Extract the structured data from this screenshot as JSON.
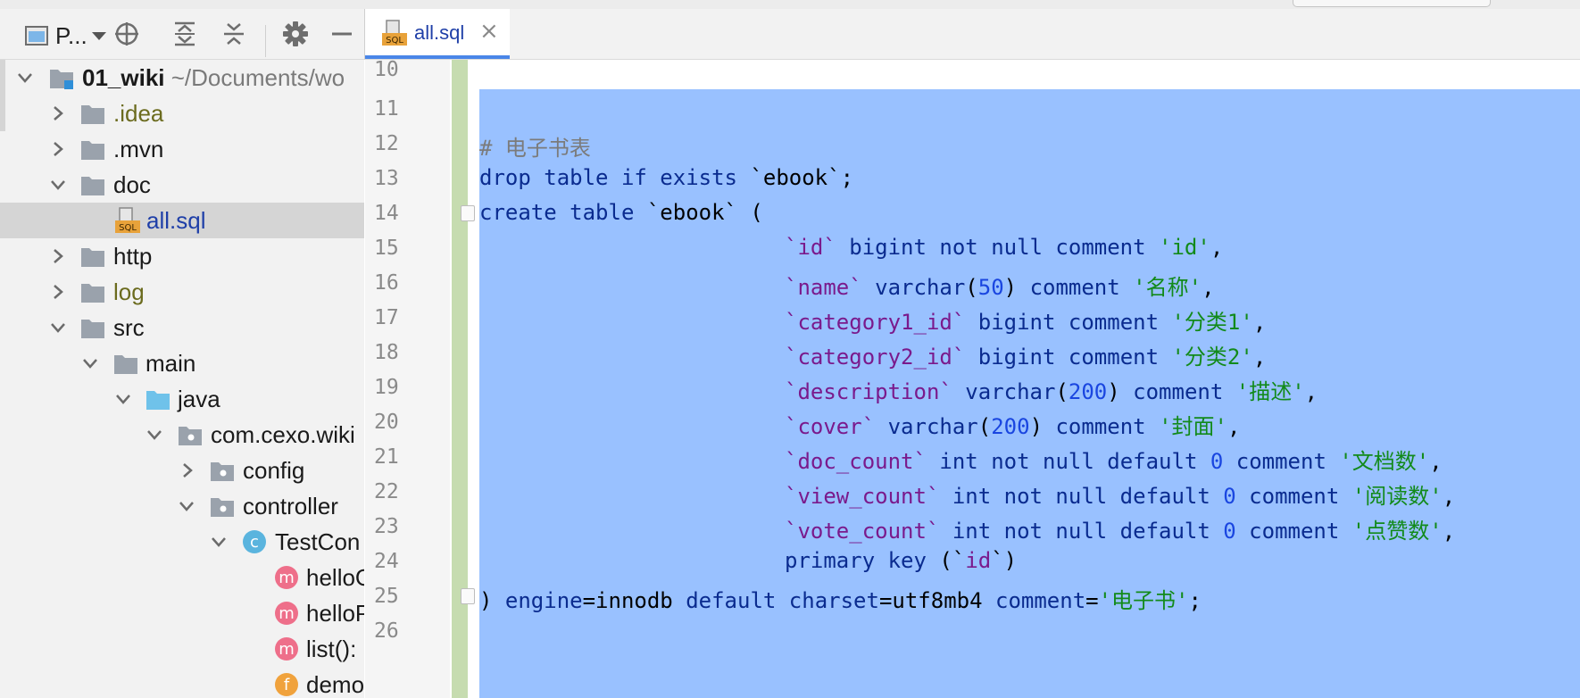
{
  "toolbar": {
    "project_label": "P...",
    "project_dropdown_icon": "triangle-down-icon"
  },
  "tabs": [
    {
      "label": "all.sql",
      "file_type_icon": "SQL",
      "active": true
    }
  ],
  "tree": {
    "root": {
      "label": "01_wiki",
      "path": "~/Documents/wo"
    },
    "items": [
      {
        "label": ".idea"
      },
      {
        "label": ".mvn"
      },
      {
        "label": "doc"
      },
      {
        "label": "all.sql",
        "icon_text": "SQL"
      },
      {
        "label": "http"
      },
      {
        "label": "log"
      },
      {
        "label": "src"
      },
      {
        "label": "main"
      },
      {
        "label": "java"
      },
      {
        "label": "com.cexo.wiki"
      },
      {
        "label": "config"
      },
      {
        "label": "controller"
      },
      {
        "label": "TestCon",
        "badge": "c"
      },
      {
        "label": "helloG",
        "badge": "m"
      },
      {
        "label": "helloP",
        "badge": "m"
      },
      {
        "label": "list():",
        "badge": "m"
      },
      {
        "label": "demo",
        "badge": "f"
      }
    ]
  },
  "editor": {
    "line_numbers": [
      "10",
      "11",
      "12",
      "13",
      "14",
      "15",
      "16",
      "17",
      "18",
      "19",
      "20",
      "21",
      "22",
      "23",
      "24",
      "25",
      "26"
    ],
    "lines": {
      "l12": {
        "cmt": "# 电子书表"
      },
      "l13": {
        "kw1": "drop table if exists",
        "ident": " `ebook`",
        "end": ";"
      },
      "l14": {
        "kw1": "create table",
        "ident": " `ebook`",
        "end": " ("
      },
      "l15": {
        "ident": "`id`",
        "kw1": " bigint not null comment ",
        "str": "'id'",
        "end": ","
      },
      "l16": {
        "ident": "`name`",
        "kw1": " varchar",
        "p1": "(",
        "num": "50",
        "p2": ") ",
        "kw2": "comment ",
        "str": "'名称'",
        "end": ","
      },
      "l17": {
        "ident": "`category1_id`",
        "kw1": " bigint comment ",
        "str": "'分类1'",
        "end": ","
      },
      "l18": {
        "ident": "`category2_id`",
        "kw1": " bigint comment ",
        "str": "'分类2'",
        "end": ","
      },
      "l19": {
        "ident": "`description`",
        "kw1": " varchar",
        "p1": "(",
        "num": "200",
        "p2": ") ",
        "kw2": "comment ",
        "str": "'描述'",
        "end": ","
      },
      "l20": {
        "ident": "`cover`",
        "kw1": " varchar",
        "p1": "(",
        "num": "200",
        "p2": ") ",
        "kw2": "comment ",
        "str": "'封面'",
        "end": ","
      },
      "l21": {
        "ident": "`doc_count`",
        "kw1": " int not null default ",
        "num": "0",
        "kw2": " comment ",
        "str": "'文档数'",
        "end": ","
      },
      "l22": {
        "ident": "`view_count`",
        "kw1": " int not null default ",
        "num": "0",
        "kw2": " comment ",
        "str": "'阅读数'",
        "end": ","
      },
      "l23": {
        "ident": "`vote_count`",
        "kw1": " int not null default ",
        "num": "0",
        "kw2": " comment ",
        "str": "'点赞数'",
        "end": ","
      },
      "l24": {
        "kw1": "primary key",
        "p1": " (`",
        "ident": "id",
        "p2": "`)"
      },
      "l25": {
        "p1": ") ",
        "kw1": "engine",
        "p2": "=innodb ",
        "kw2": "default charset",
        "p3": "=utf8mb4 ",
        "kw3": "comment",
        "p4": "=",
        "str": "'电子书'",
        "end": ";"
      }
    }
  },
  "colors": {
    "selection": "#99c1ff",
    "keyword": "#0a2b8f",
    "identifier": "#7a1a8c",
    "string": "#128a1a",
    "number": "#1a46e0",
    "tab_underline": "#4a86e8"
  }
}
